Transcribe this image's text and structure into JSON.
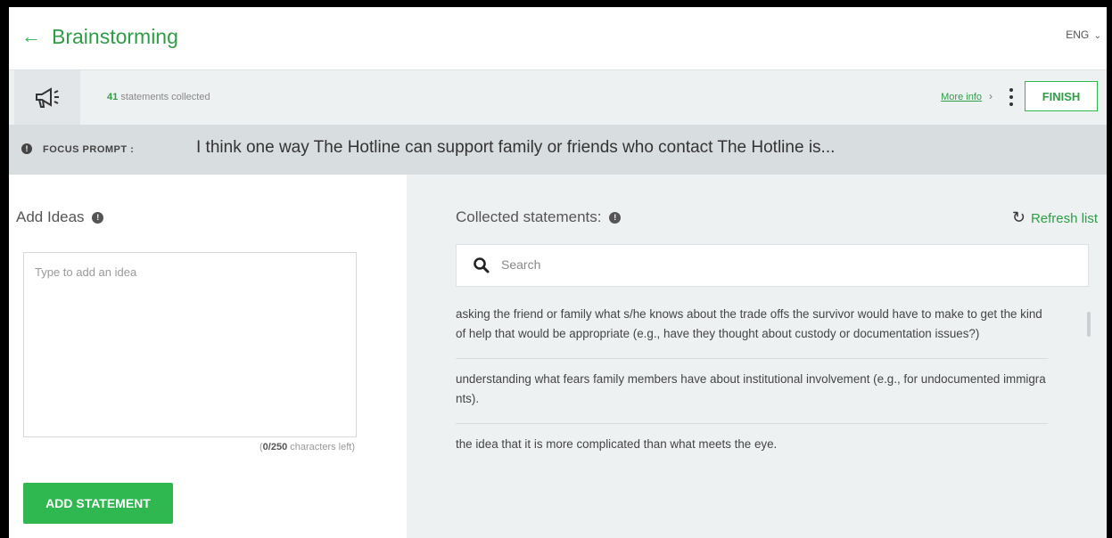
{
  "header": {
    "back_icon": "arrow-left-icon",
    "title": "Brainstorming",
    "language": "ENG"
  },
  "toolbar": {
    "megaphone_icon": "megaphone-icon",
    "statement_count": "41",
    "count_suffix": "statements collected",
    "more_info_label": "More info",
    "more_info_chevron": "›",
    "finish_label": "FINISH"
  },
  "prompt": {
    "label": "FOCUS PROMPT :",
    "text": "I think one way The Hotline can support family or friends who contact The Hotline is..."
  },
  "left": {
    "title": "Add Ideas",
    "input_placeholder": "Type to add an idea",
    "char_count_current": "0/250",
    "char_count_suffix": "characters left)",
    "add_button_label": "ADD STATEMENT"
  },
  "right": {
    "title": "Collected statements:",
    "refresh_label": "Refresh list",
    "search_placeholder": "Search",
    "statements": [
      "asking the friend or family what s/he knows about the trade offs the survivor would have to make to get the kind of help that would be appropriate (e.g., have they thought about custody or documentation issues?)",
      "understanding what fears family members have about institutional involvement (e.g., for undocumented immigrants).",
      "the idea that it is more complicated than what meets the eye."
    ]
  },
  "colors": {
    "accent": "#2eb84f",
    "accent_text": "#2e9e46",
    "toolbar_bg": "#eef1f2",
    "prompt_bg": "#d8dde0"
  }
}
